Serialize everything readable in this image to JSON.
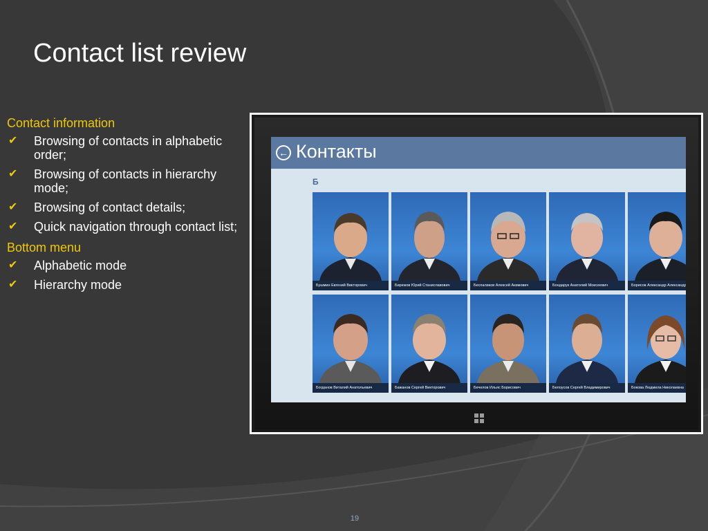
{
  "slide": {
    "title": "Contact list review",
    "page_number": "19"
  },
  "sections": [
    {
      "heading": "Contact information",
      "items": [
        "Browsing of contacts in alphabetic order;",
        "Browsing of contacts in hierarchy mode;",
        "Browsing of contact details;",
        "Quick navigation through contact list;"
      ]
    },
    {
      "heading": "Bottom menu",
      "items": [
        "Alphabetic mode",
        "Hierarchy mode"
      ]
    }
  ],
  "app": {
    "title": "Контакты",
    "back_icon": "back-arrow-icon",
    "group_letter": "Б",
    "contacts": [
      "Бушмин Евгений Викторович",
      "Бирюков Юрий Станиславович",
      "Беспаликов Алексей Акимович",
      "Бондарук Анатолий Моисеевич",
      "Борисов Александр Александрович",
      "Богданов Виталий Анатольевич",
      "Бажанов Сергей Викторович",
      "Бечелов Ильяс Борисович",
      "Белоусов Сергей Владимирович",
      "Бокова Людмила Николаевна"
    ]
  },
  "colors": {
    "accent": "#f0c808",
    "app_header": "#5a78a0",
    "app_background": "#d8e4ee",
    "tile_background": "#3b7fd0"
  }
}
